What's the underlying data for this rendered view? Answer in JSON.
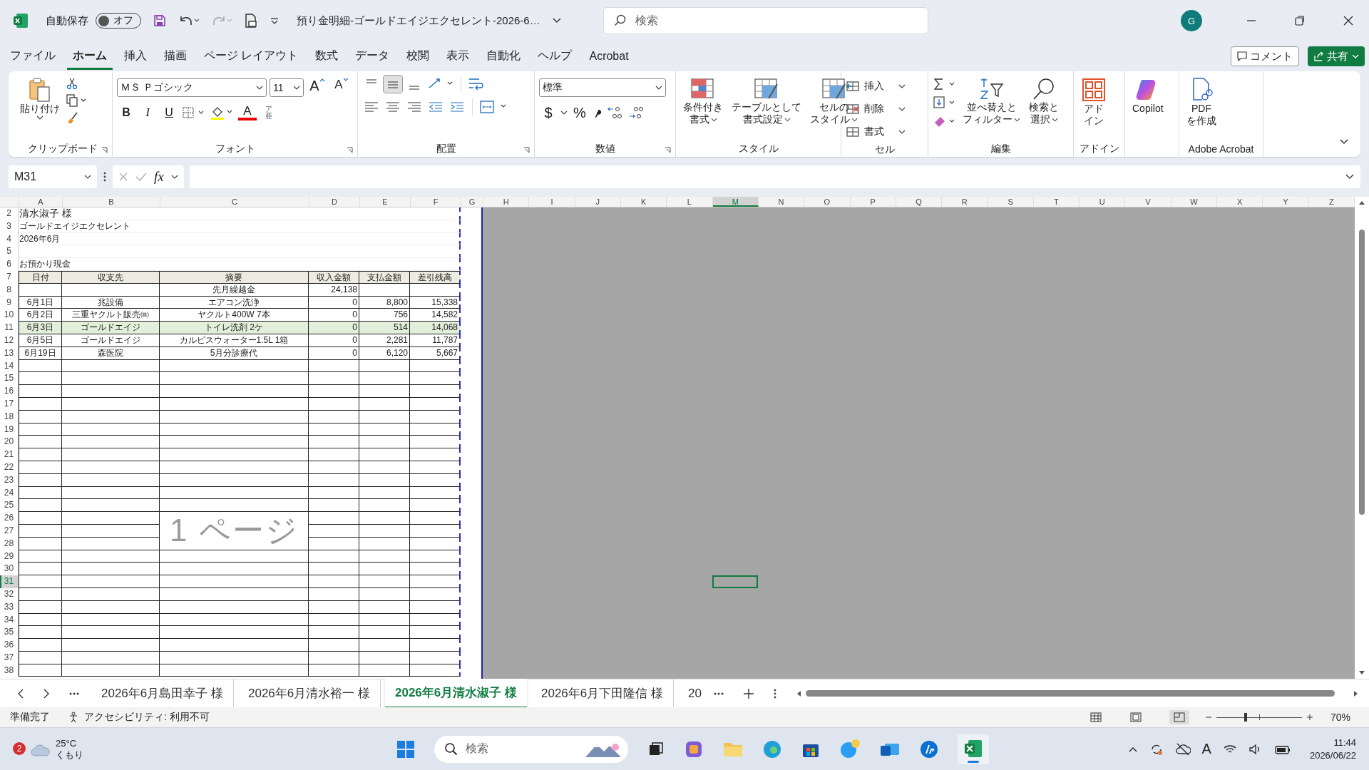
{
  "title_bar": {
    "autosave_label": "自動保存",
    "autosave_state": "オフ",
    "autosave_on": false,
    "document_title": "預り金明細-ゴールドエイジエクセレント-2026-6…",
    "search_placeholder": "検索",
    "avatar": "G"
  },
  "menu_tabs": [
    {
      "label": "ファイル",
      "selected": false
    },
    {
      "label": "ホーム",
      "selected": true
    },
    {
      "label": "挿入",
      "selected": false
    },
    {
      "label": "描画",
      "selected": false
    },
    {
      "label": "ページ レイアウト",
      "selected": false
    },
    {
      "label": "数式",
      "selected": false
    },
    {
      "label": "データ",
      "selected": false
    },
    {
      "label": "校閲",
      "selected": false
    },
    {
      "label": "表示",
      "selected": false
    },
    {
      "label": "自動化",
      "selected": false
    },
    {
      "label": "ヘルプ",
      "selected": false
    },
    {
      "label": "Acrobat",
      "selected": false
    }
  ],
  "comment_button": "コメント",
  "share_button": "共有",
  "ribbon": {
    "clipboard": {
      "label": "クリップボード",
      "paste": "貼り付け"
    },
    "font": {
      "label": "フォント",
      "font_name": "ＭＳ Ｐゴシック",
      "font_size": "11",
      "grow": "A",
      "shrink": "A",
      "bold": "B",
      "italic": "I",
      "underline": "U",
      "font_color": "A",
      "phonetic": [
        "ア",
        "亜"
      ]
    },
    "alignment": {
      "label": "配置",
      "vertical": [
        {
          "selected": false
        },
        {
          "selected": true
        },
        {
          "selected": false
        }
      ]
    },
    "number": {
      "label": "数値",
      "format": "標準",
      "currency": "$",
      "percent": "%"
    },
    "styles": {
      "label": "スタイル",
      "buttons": [
        [
          "条件付き",
          "書式"
        ],
        [
          "テーブルとして",
          "書式設定"
        ],
        [
          "セルの",
          "スタイル"
        ]
      ]
    },
    "cells": {
      "label": "セル",
      "buttons": [
        "挿入",
        "削除",
        "書式"
      ]
    },
    "editing": {
      "label": "編集",
      "buttons": [
        [
          "並べ替えと",
          "フィルター"
        ],
        [
          "検索と",
          "選択"
        ]
      ]
    },
    "addins": {
      "label": "アドイン",
      "button": [
        "アド",
        "イン"
      ]
    },
    "copilot": {
      "button": "Copilot"
    },
    "acrobat": {
      "label": "Adobe Acrobat",
      "button": [
        "PDF",
        "を作成"
      ]
    }
  },
  "formula_bar": {
    "name_box": "M31",
    "function_label": "fx"
  },
  "sheet": {
    "page_label": "1 ページ",
    "columns": [
      {
        "label": "A",
        "selected": false
      },
      {
        "label": "B",
        "selected": false
      },
      {
        "label": "C",
        "selected": false
      },
      {
        "label": "D",
        "selected": false
      },
      {
        "label": "E",
        "selected": false
      },
      {
        "label": "F",
        "selected": false
      },
      {
        "label": "G",
        "selected": false
      },
      {
        "label": "H",
        "selected": false
      },
      {
        "label": "I",
        "selected": false
      },
      {
        "label": "J",
        "selected": false
      },
      {
        "label": "K",
        "selected": false
      },
      {
        "label": "L",
        "selected": false
      },
      {
        "label": "M",
        "selected": true
      },
      {
        "label": "N",
        "selected": false
      },
      {
        "label": "O",
        "selected": false
      },
      {
        "label": "P",
        "selected": false
      },
      {
        "label": "Q",
        "selected": false
      },
      {
        "label": "R",
        "selected": false
      },
      {
        "label": "S",
        "selected": false
      },
      {
        "label": "T",
        "selected": false
      },
      {
        "label": "U",
        "selected": false
      },
      {
        "label": "V",
        "selected": false
      },
      {
        "label": "W",
        "selected": false
      },
      {
        "label": "X",
        "selected": false
      },
      {
        "label": "Y",
        "selected": false
      },
      {
        "label": "Z",
        "selected": false
      }
    ],
    "rows": [
      {
        "number": "2",
        "selected": false,
        "kind": "title",
        "text": "清水淑子 様"
      },
      {
        "number": "3",
        "selected": false,
        "kind": "text",
        "text": "ゴールドエイジエクセレント"
      },
      {
        "number": "4",
        "selected": false,
        "kind": "text",
        "text": "2026年6月"
      },
      {
        "number": "5",
        "selected": false,
        "kind": "spacer"
      },
      {
        "number": "6",
        "selected": false,
        "kind": "text",
        "text": "お預かり現金"
      },
      {
        "number": "7",
        "selected": false,
        "kind": "header",
        "cells": [
          "日付",
          "収支先",
          "摘要",
          "収入金額",
          "支払金額",
          "差引残高"
        ]
      },
      {
        "number": "8",
        "selected": false,
        "kind": "entry",
        "highlighted": false,
        "description": "先月繰越金",
        "income": "24,138"
      },
      {
        "number": "9",
        "selected": false,
        "kind": "entry",
        "highlighted": false,
        "date": "6月1日",
        "payee": "兆設備",
        "description": "エアコン洗浄",
        "income": "0",
        "payment": "8,800",
        "balance": "15,338"
      },
      {
        "number": "10",
        "selected": false,
        "kind": "entry",
        "highlighted": false,
        "date": "6月2日",
        "payee": "三重ヤクルト販売㈱",
        "description": "ヤクルト400W 7本",
        "income": "0",
        "payment": "756",
        "balance": "14,582"
      },
      {
        "number": "11",
        "selected": false,
        "kind": "entry",
        "highlighted": true,
        "date": "6月3日",
        "payee": "ゴールドエイジ",
        "description": "トイレ洗剤 2ケ",
        "income": "0",
        "payment": "514",
        "balance": "14,068"
      },
      {
        "number": "12",
        "selected": false,
        "kind": "entry",
        "highlighted": false,
        "date": "6月5日",
        "payee": "ゴールドエイジ",
        "description": "カルピスウォーター1.5L 1箱",
        "income": "0",
        "payment": "2,281",
        "balance": "11,787"
      },
      {
        "number": "13",
        "selected": false,
        "kind": "entry",
        "highlighted": false,
        "date": "6月19日",
        "payee": "森医院",
        "description": "5月分診療代",
        "income": "0",
        "payment": "6,120",
        "balance": "5,667"
      },
      {
        "number": "14",
        "selected": false,
        "kind": "empty"
      },
      {
        "number": "15",
        "selected": false,
        "kind": "empty"
      },
      {
        "number": "16",
        "selected": false,
        "kind": "empty"
      },
      {
        "number": "17",
        "selected": false,
        "kind": "empty"
      },
      {
        "number": "18",
        "selected": false,
        "kind": "empty"
      },
      {
        "number": "19",
        "selected": false,
        "kind": "empty"
      },
      {
        "number": "20",
        "selected": false,
        "kind": "empty"
      },
      {
        "number": "21",
        "selected": false,
        "kind": "empty"
      },
      {
        "number": "22",
        "selected": false,
        "kind": "empty"
      },
      {
        "number": "23",
        "selected": false,
        "kind": "empty"
      },
      {
        "number": "24",
        "selected": false,
        "kind": "empty"
      },
      {
        "number": "25",
        "selected": false,
        "kind": "empty"
      },
      {
        "number": "26",
        "selected": false,
        "kind": "empty"
      },
      {
        "number": "27",
        "selected": false,
        "kind": "empty"
      },
      {
        "number": "28",
        "selected": false,
        "kind": "empty"
      },
      {
        "number": "29",
        "selected": false,
        "kind": "empty"
      },
      {
        "number": "30",
        "selected": false,
        "kind": "empty"
      },
      {
        "number": "31",
        "selected": true,
        "kind": "empty"
      },
      {
        "number": "32",
        "selected": false,
        "kind": "empty"
      },
      {
        "number": "33",
        "selected": false,
        "kind": "empty"
      },
      {
        "number": "34",
        "selected": false,
        "kind": "empty"
      },
      {
        "number": "35",
        "selected": false,
        "kind": "empty"
      },
      {
        "number": "36",
        "selected": false,
        "kind": "empty"
      },
      {
        "number": "37",
        "selected": false,
        "kind": "empty"
      },
      {
        "number": "38",
        "selected": false,
        "kind": "empty"
      }
    ]
  },
  "sheet_tabs": [
    {
      "label": "2026年6月島田幸子 様",
      "selected": false
    },
    {
      "label": "2026年6月清水裕一 様",
      "selected": false
    },
    {
      "label": "2026年6月清水淑子 様",
      "selected": true
    },
    {
      "label": "2026年6月下田隆信 様",
      "selected": false
    },
    {
      "label": "20",
      "selected": false
    }
  ],
  "status_bar": {
    "ready": "準備完了",
    "accessibility": "アクセシビリティ: 利用不可",
    "zoom": "70%",
    "zoom_level": {
      "level": 0.34
    }
  },
  "taskbar": {
    "weather_badge": "2",
    "temperature": "25°C",
    "weather": "くもり",
    "search_placeholder": "検索",
    "ime": "A",
    "time": "11:44",
    "date": "2026/06/22"
  }
}
